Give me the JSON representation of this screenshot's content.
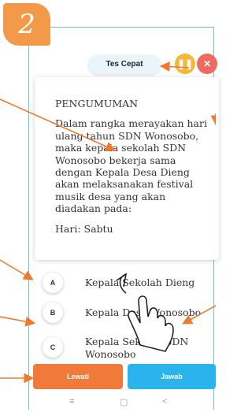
{
  "step_number": "2",
  "header": {
    "mode_label": "Tes Cepat",
    "pause_icon": "pause-icon",
    "close_icon": "close-icon"
  },
  "announcement": {
    "title": "PENGUMUMAN",
    "body": "Dalam rangka merayakan hari ulang tahun SDN Wonosobo, maka kepala sekolah SDN Wonosobo bekerja sama dengan Kepala Desa Dieng akan melaksanakan festival musik desa yang akan diadakan pada:",
    "detail": "Hari: Sabtu"
  },
  "options": [
    {
      "letter": "A",
      "text": "Kepala Sekolah Dieng"
    },
    {
      "letter": "B",
      "text": "Kepala Desa Wonosobo"
    },
    {
      "letter": "C",
      "text": "Kepala Sekolah SDN Wonosobo"
    }
  ],
  "buttons": {
    "skip": "Lewati",
    "answer": "Jawab"
  },
  "navbar": {
    "menu_glyph": "≡",
    "home_glyph": "▢",
    "back_glyph": "<"
  },
  "colors": {
    "badge": "#f39a4a",
    "frame": "#6fc7c0",
    "skip": "#f17a3a",
    "answer": "#2ab4ee",
    "arrow": "#f07a2a"
  },
  "icons": [
    "hand-pointer-icon",
    "pause-icon",
    "close-icon"
  ]
}
